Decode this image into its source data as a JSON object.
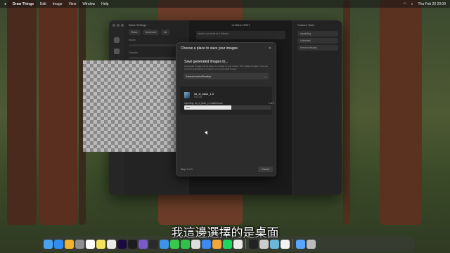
{
  "menubar": {
    "app_name": "Draw Things",
    "menus": [
      "Edit",
      "Image",
      "View",
      "Window",
      "Help"
    ],
    "clock": "Thu Feb 20  20:09"
  },
  "window": {
    "settings_title": "Basic Settings",
    "settings_tabs": [
      "Basic",
      "Advanced",
      "All"
    ],
    "sections": [
      "Model",
      "Sampler",
      "LoRA",
      "Strength",
      "Control",
      "Upscaler",
      "Steps"
    ],
    "document_title": "Untitled-29907",
    "prompt_placeholder": "search a portrait of a Wearin",
    "right_panel_title": "Custom Tools",
    "right_panel_items": [
      "Inpainting",
      "Unlimited",
      "Version History"
    ]
  },
  "modal": {
    "title": "Choose a place to save your images",
    "heading": "Save generated images to...",
    "description": "Generated images can be saved to a folder of your choice. This makes it easier if you use external applications to organize your generated images.",
    "path": "/Users/chunhu/Desktop",
    "model_name": "sd_xl_base_1.0",
    "model_size": "6.94 GB",
    "import_label": "Importing: sd_xl_base_1.0.safetensors",
    "import_count": "1 of 1",
    "progress_text": "54%",
    "progress_value": 0.54,
    "step_text": "Step 1 of 1",
    "cancel_label": "Cancel"
  },
  "subtitle": "我這邊選擇的是桌面",
  "dock": {
    "icons": [
      "finder-icon",
      "safari-icon",
      "chrome-icon",
      "settings-icon",
      "calendar-icon",
      "notes-icon",
      "reminders-icon",
      "premiere-icon",
      "davinci-icon",
      "obsidian-icon",
      "typora-icon",
      "folder-icon",
      "messages-icon",
      "facetime-icon",
      "fontbook-icon",
      "keynote-icon",
      "photos-icon",
      "spotify-icon",
      "chatgpt-icon",
      "terminal-icon",
      "text-icon",
      "drawthings-icon",
      "capcut-icon",
      "archive-icon",
      "trash-icon"
    ],
    "colors": [
      "#4aa3f0",
      "#2f8cf5",
      "#f0b32c",
      "#8e8e93",
      "#fff",
      "#f5e25c",
      "#e9e9e9",
      "#1b0a3d",
      "#1d1d1d",
      "#7a5ac8",
      "#2a2a2a",
      "#3b94ea",
      "#36c94a",
      "#31c04c",
      "#ddd",
      "#3a8af0",
      "#f4a63a",
      "#1ed760",
      "#eaeaea",
      "#222",
      "#ccc",
      "#6bb7d9",
      "#f2f2f2",
      "#58a6ff",
      "#bbb"
    ]
  }
}
